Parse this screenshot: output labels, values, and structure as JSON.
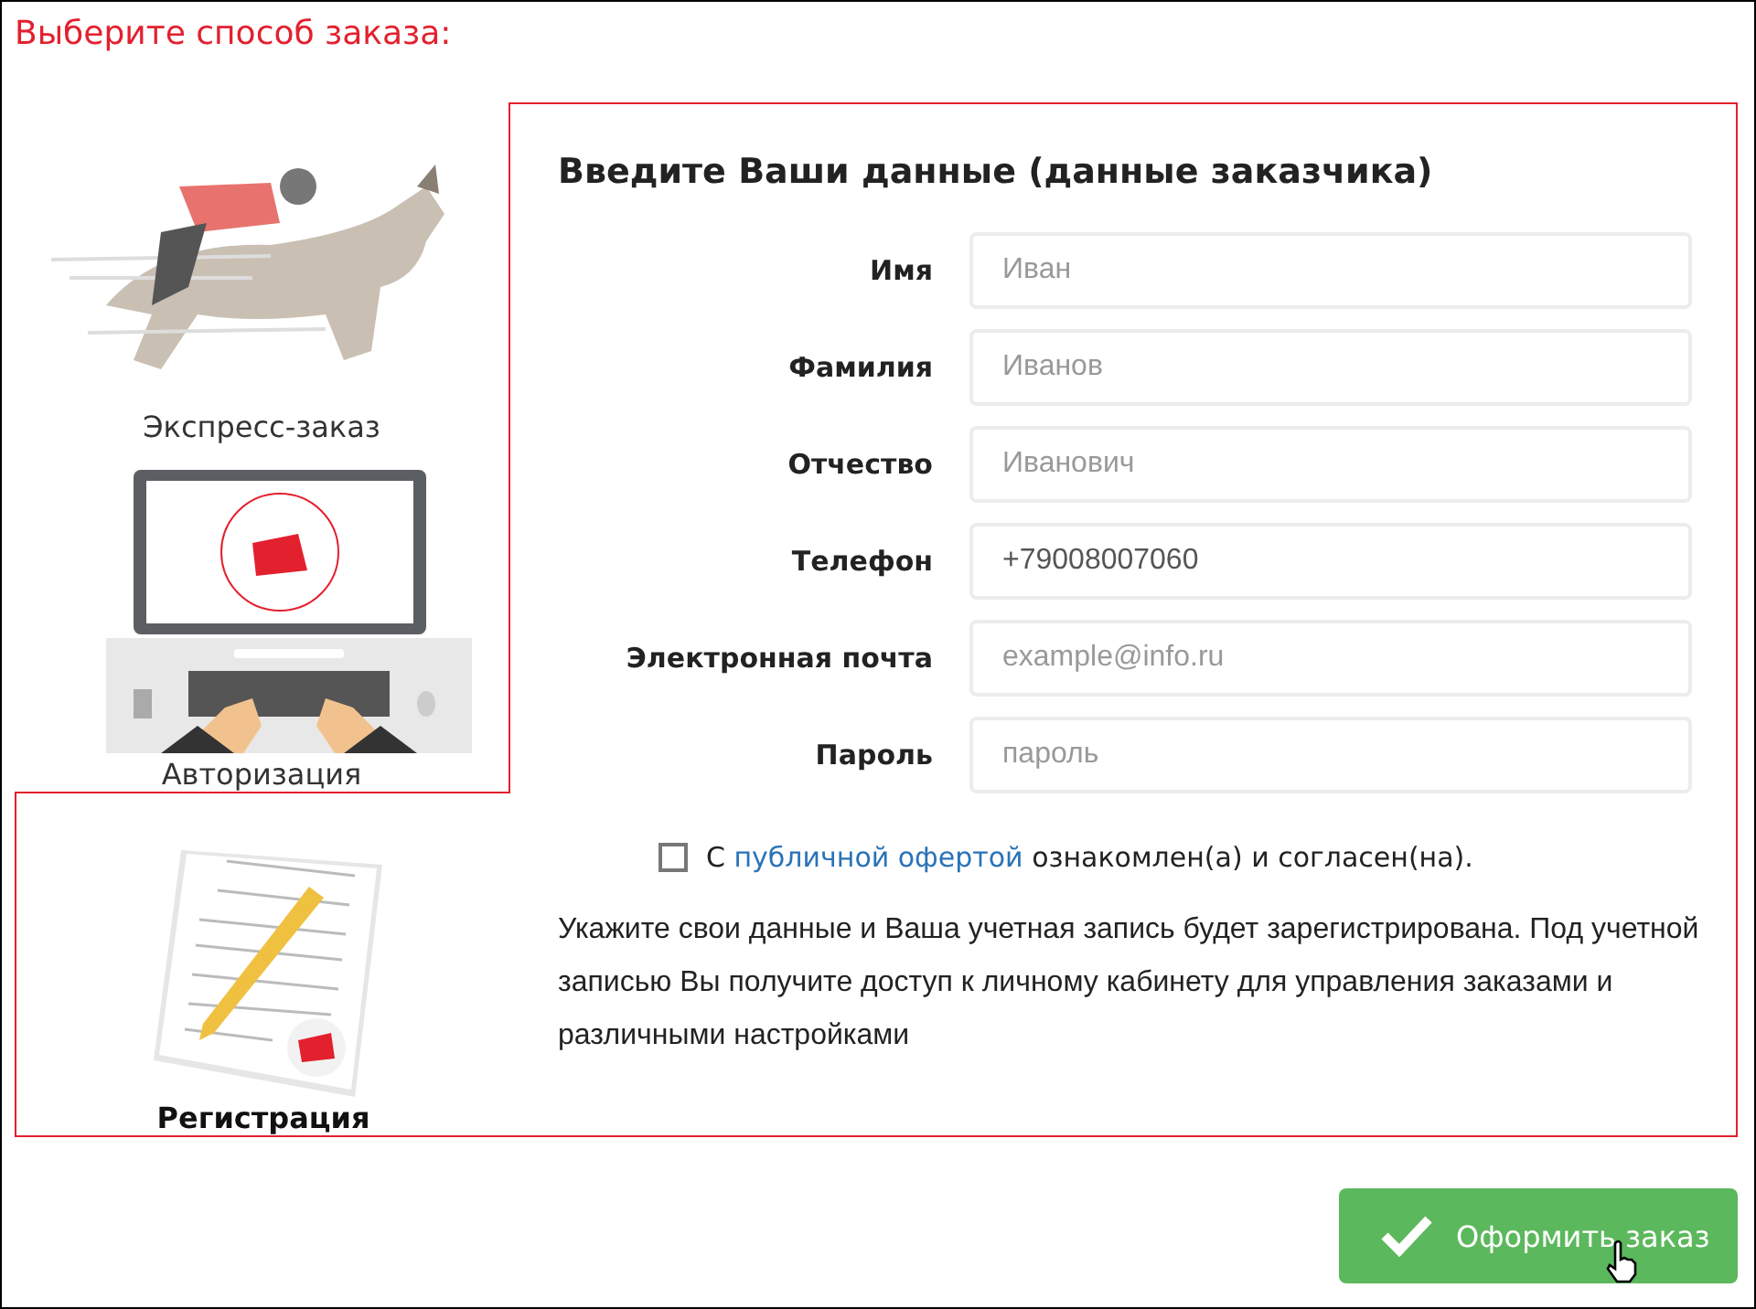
{
  "heading": "Выберите способ заказа:",
  "options": [
    {
      "label": "Экспресс-заказ",
      "kind": "express",
      "selected": false
    },
    {
      "label": "Авторизация",
      "kind": "login",
      "selected": false
    },
    {
      "label": "Регистрация",
      "kind": "register",
      "selected": true
    }
  ],
  "form": {
    "title": "Введите Ваши данные (данные заказчика)",
    "fields": [
      {
        "label": "Имя",
        "placeholder": "Иван"
      },
      {
        "label": "Фамилия",
        "placeholder": "Иванов"
      },
      {
        "label": "Отчество",
        "placeholder": "Иванович"
      },
      {
        "label": "Телефон",
        "value": "+79008007060"
      },
      {
        "label": "Электронная почта",
        "placeholder": "example@info.ru"
      },
      {
        "label": "Пароль",
        "placeholder": "пароль"
      }
    ],
    "agreement": {
      "checked": false,
      "before": "С ",
      "link": "публичной офертой",
      "after": " ознакомлен(а) и согласен(на)."
    },
    "note": "Укажите свои данные и Ваша учетная запись будет зарегистрирована. Под учетной записью Вы получите доступ к личному кабинету для управления заказами и различными настройками"
  },
  "submit": "Оформить заказ"
}
